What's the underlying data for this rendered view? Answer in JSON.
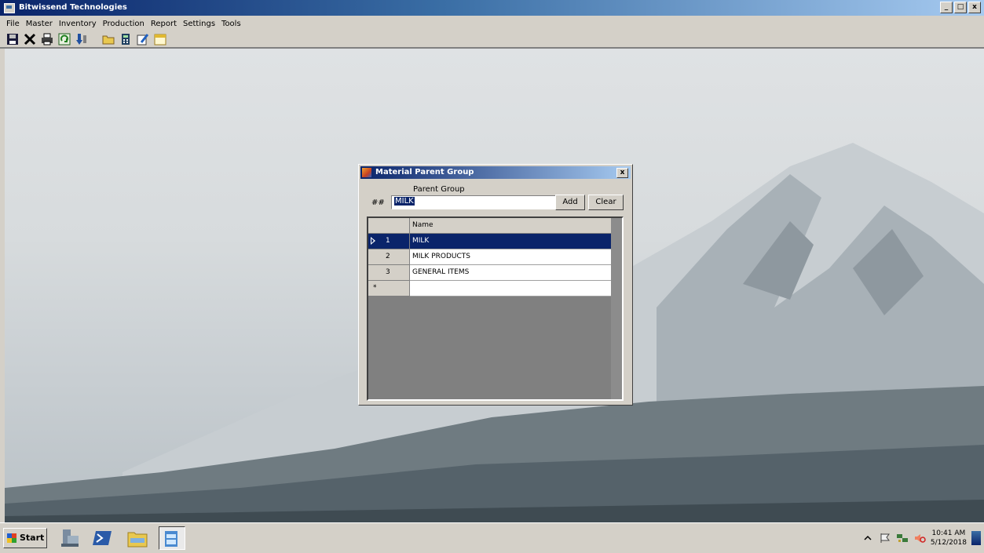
{
  "window": {
    "title": "Bitwissend Technologies",
    "buttons": [
      "_",
      "□",
      "x"
    ]
  },
  "menu": [
    "File",
    "Master",
    "Inventory",
    "Production",
    "Report",
    "Settings",
    "Tools"
  ],
  "toolbar": {
    "icons": [
      "save-icon",
      "delete-icon",
      "print-icon",
      "refresh-icon",
      "download-icon",
      "folder-icon",
      "calculator-icon",
      "edit-icon",
      "calendar-icon"
    ]
  },
  "dialog": {
    "title": "Material Parent Group",
    "close_label": "x",
    "parent_group_label": "Parent Group",
    "code_label": "##",
    "input_value": "MILK",
    "add_label": "Add",
    "clear_label": "Clear",
    "grid": {
      "column_header": "Name",
      "rows": [
        {
          "num": "1",
          "name": "MILK",
          "selected": true
        },
        {
          "num": "2",
          "name": "MILK PRODUCTS"
        },
        {
          "num": "3",
          "name": "GENERAL ITEMS"
        }
      ],
      "new_row_marker": "*"
    }
  },
  "taskbar": {
    "start_label": "Start",
    "apps": [
      "server-manager-icon",
      "powershell-icon",
      "file-explorer-icon",
      "application-icon"
    ],
    "clock_time": "10:41 AM",
    "clock_date": "5/12/2018"
  }
}
